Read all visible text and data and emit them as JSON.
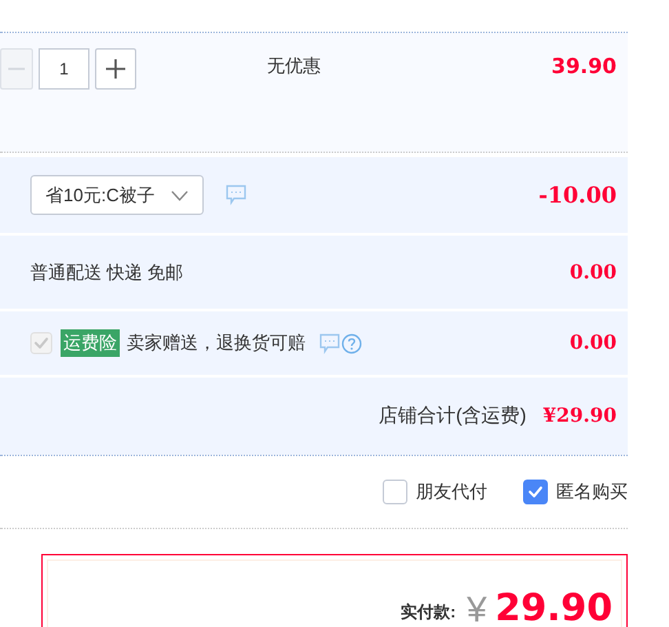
{
  "item": {
    "minus": {
      "disabled": true
    },
    "quantity": "1",
    "promotion": "无优惠",
    "price": "39.90"
  },
  "coupon": {
    "value": "省10元:C被子",
    "amount": "-10.00"
  },
  "shipping": {
    "label": "普通配送 快递 免邮",
    "amount": "0.00"
  },
  "insurance": {
    "checked": true,
    "disabled": true,
    "tag": "运费险",
    "text": "卖家赠送，退换货可赔",
    "amount": "0.00"
  },
  "total": {
    "label": "店铺合计(含运费)",
    "amount": "¥29.90"
  },
  "options": [
    {
      "label": "朋友代付",
      "checked": false
    },
    {
      "label": "匿名购买",
      "checked": true
    }
  ],
  "payment": {
    "label": "实付款:",
    "currency": "¥",
    "amount": "29.90"
  }
}
